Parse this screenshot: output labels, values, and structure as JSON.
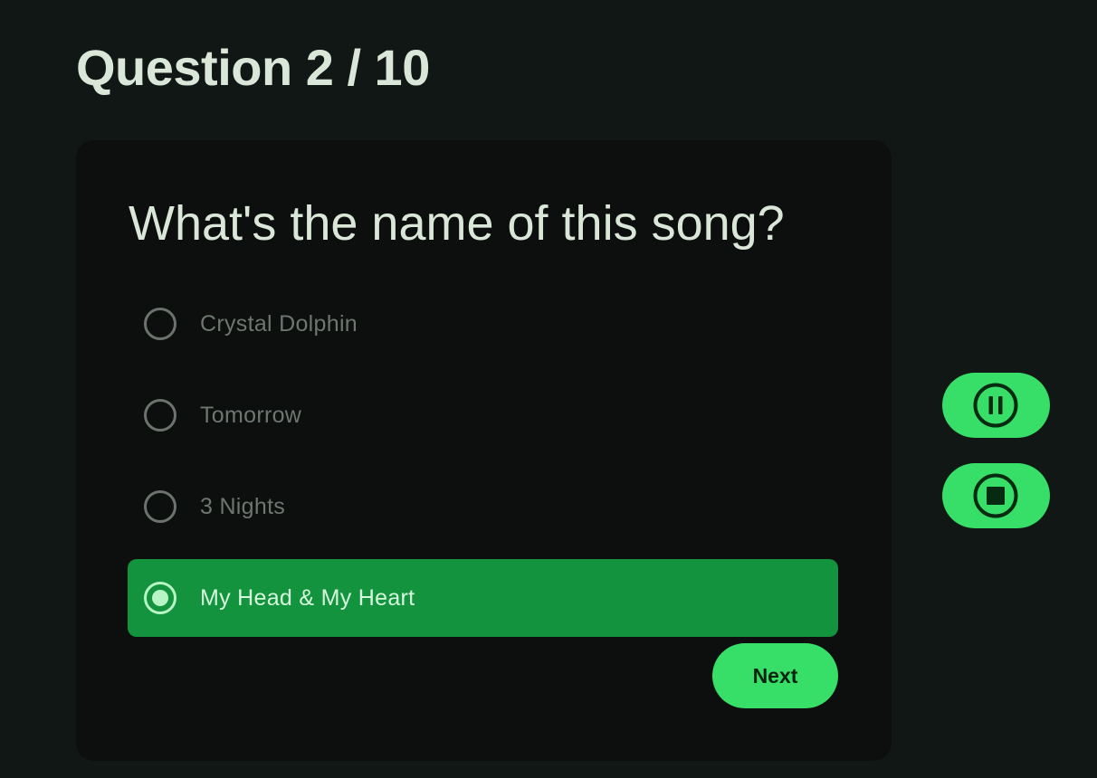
{
  "header": {
    "title": "Question 2 / 10"
  },
  "question": {
    "prompt": "What's the name of this song?",
    "options": [
      {
        "label": "Crystal Dolphin",
        "selected": false
      },
      {
        "label": "Tomorrow",
        "selected": false
      },
      {
        "label": "3 Nights",
        "selected": false
      },
      {
        "label": "My Head & My Heart",
        "selected": true
      }
    ],
    "next_label": "Next"
  },
  "player": {
    "controls": [
      {
        "name": "pause",
        "icon": "pause-circle-icon"
      },
      {
        "name": "stop",
        "icon": "stop-circle-icon"
      }
    ]
  },
  "colors": {
    "background": "#111714",
    "card": "#0c0f0d",
    "accent": "#37de67",
    "selected_option": "#13933e",
    "text": "#d9e6d8",
    "muted_text": "#6f7670"
  }
}
